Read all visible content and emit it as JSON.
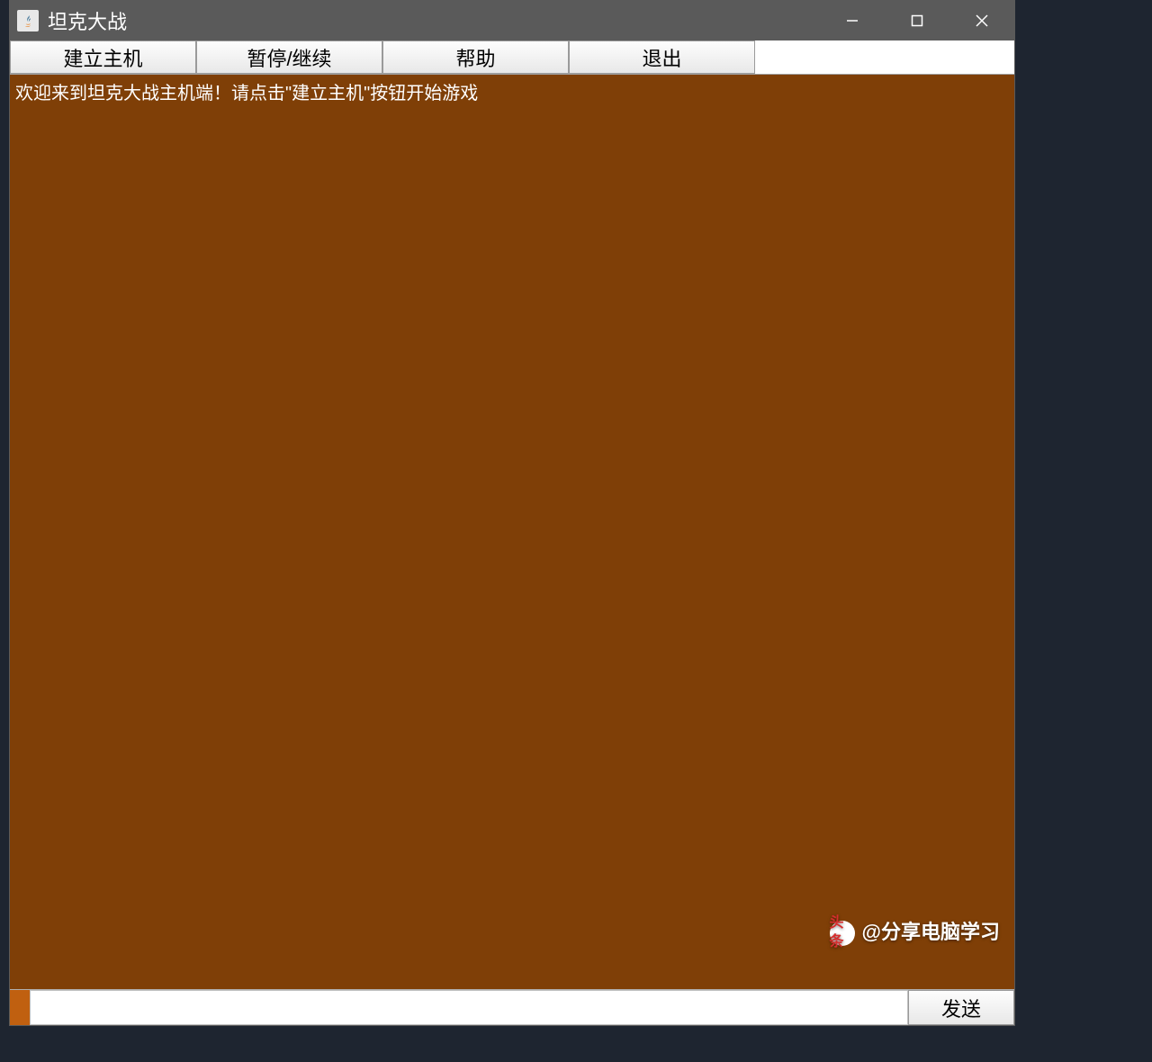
{
  "window": {
    "title": "坦克大战"
  },
  "menu": {
    "items": [
      {
        "label": "建立主机"
      },
      {
        "label": "暂停/继续"
      },
      {
        "label": "帮助"
      },
      {
        "label": "退出"
      }
    ]
  },
  "content": {
    "welcome_text": "欢迎来到坦克大战主机端！请点击\"建立主机\"按钮开始游戏"
  },
  "footer": {
    "send_label": "发送"
  },
  "watermark": {
    "logo_text": "头条",
    "text": "@分享电脑学习"
  }
}
